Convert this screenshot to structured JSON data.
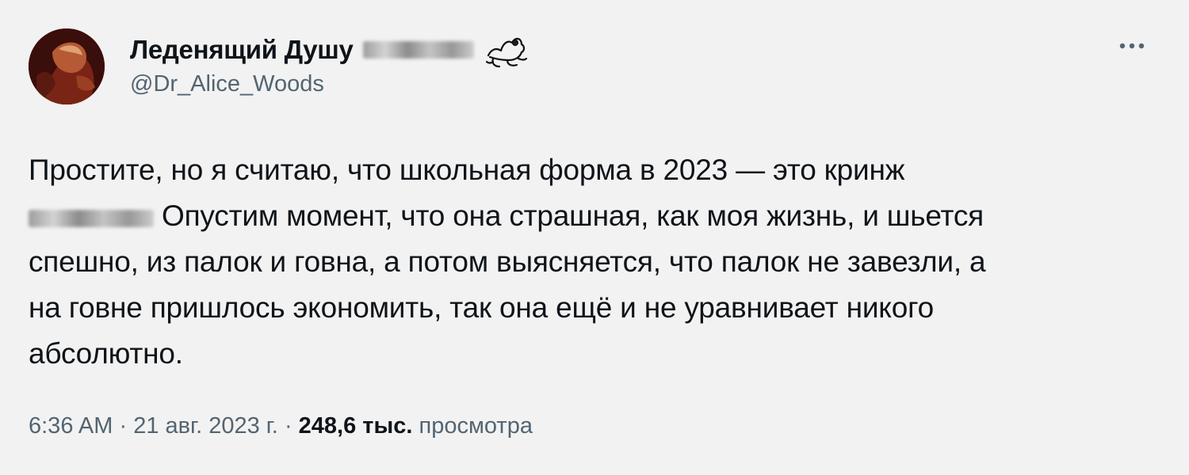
{
  "author": {
    "display_name": "Леденящий Душу",
    "handle": "@Dr_Alice_Woods",
    "name_emoji_icon": "frog-icon"
  },
  "tweet": {
    "lines": [
      "Простите, но я считаю, что школьная форма в 2023 — это кринж",
      "Опустим момент, что она страшная, как моя жизнь, и шьется",
      "спешно, из палок и говна, а потом выясняется, что палок не завезли, а",
      "на говне пришлось экономить, так она ещё и не уравнивает никого",
      "абсолютно."
    ]
  },
  "meta": {
    "time": "6:36 AM",
    "separator": "·",
    "date": "21 авг. 2023 г.",
    "views_count": "248,6 тыс.",
    "views_label": "просмотра"
  },
  "icons": {
    "more": "more-options-icon"
  },
  "colors": {
    "background": "#f2f2f2",
    "text": "#0f1419",
    "secondary": "#536471"
  }
}
